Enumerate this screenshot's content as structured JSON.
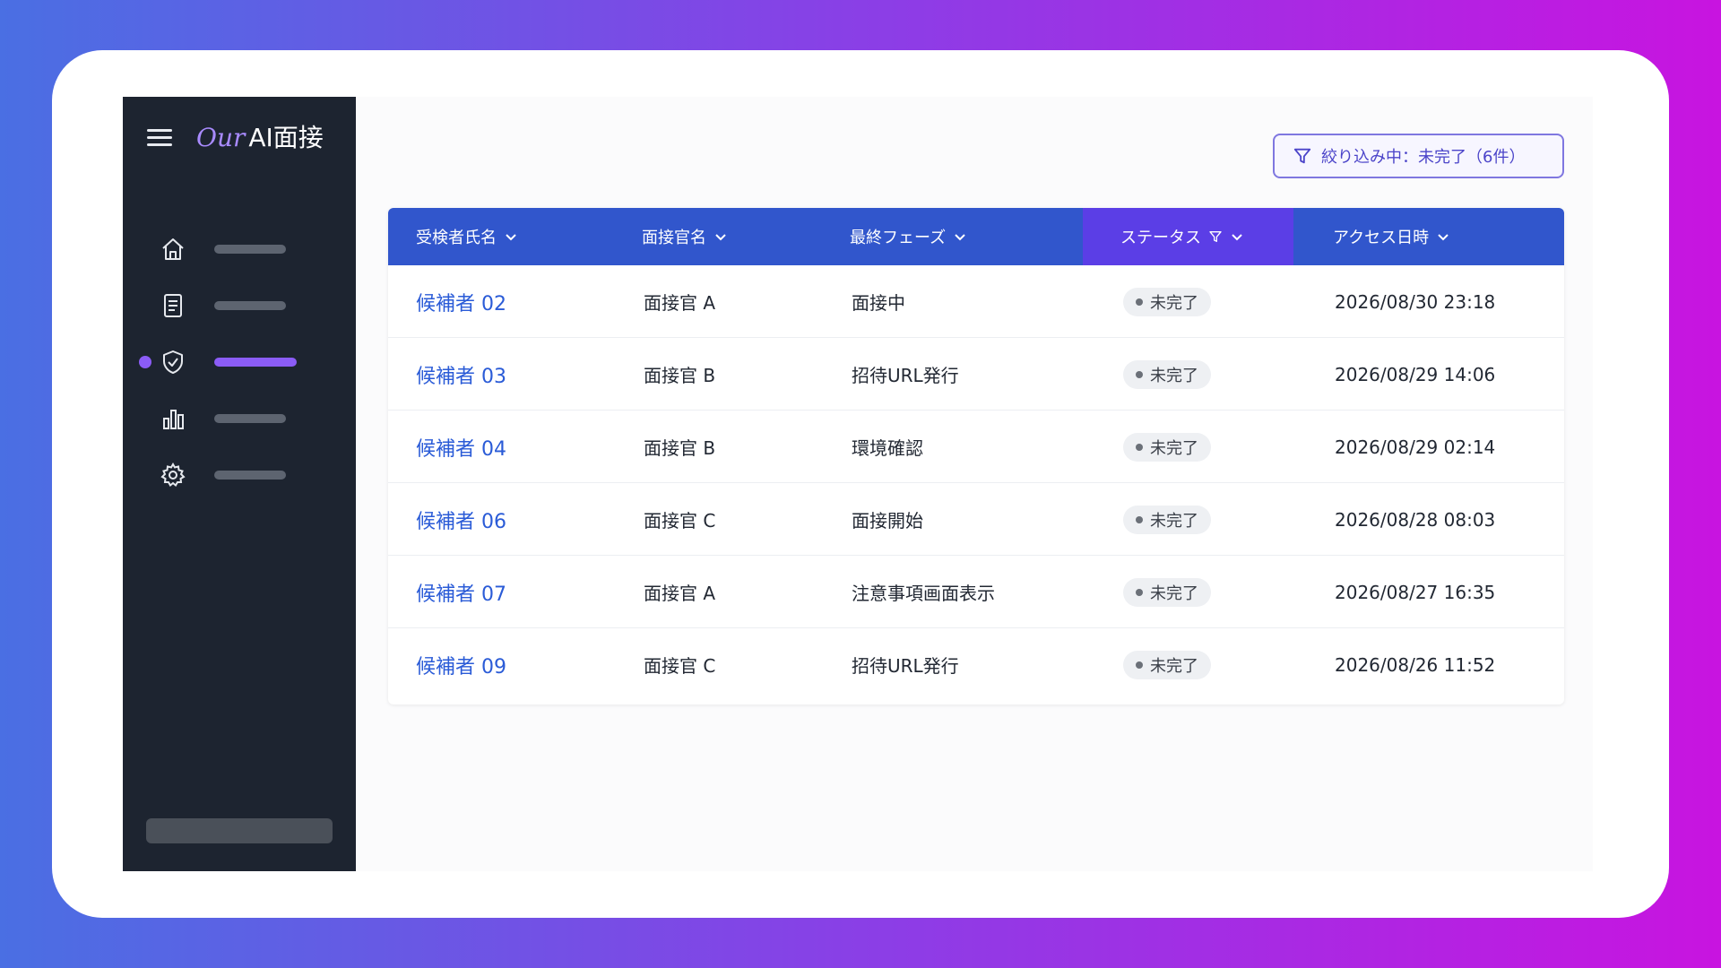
{
  "brand": {
    "prefix": "Our",
    "name": "AI面接"
  },
  "sidebar": {
    "items": [
      {
        "icon": "home-icon",
        "active": false
      },
      {
        "icon": "document-icon",
        "active": false
      },
      {
        "icon": "shield-check-icon",
        "active": true
      },
      {
        "icon": "bar-chart-icon",
        "active": false
      },
      {
        "icon": "gear-icon",
        "active": false
      }
    ]
  },
  "filter_chip": {
    "label": "絞り込み中：未完了（6件）"
  },
  "table": {
    "headers": [
      "受検者氏名",
      "面接官名",
      "最終フェーズ",
      "ステータス",
      "アクセス日時"
    ],
    "rows": [
      {
        "candidate": "候補者 02",
        "interviewer": "面接官 A",
        "phase": "面接中",
        "status": "未完了",
        "access": "2026/08/30  23:18"
      },
      {
        "candidate": "候補者 03",
        "interviewer": "面接官 B",
        "phase": "招待URL発行",
        "status": "未完了",
        "access": "2026/08/29  14:06"
      },
      {
        "candidate": "候補者 04",
        "interviewer": "面接官 B",
        "phase": "環境確認",
        "status": "未完了",
        "access": "2026/08/29  02:14"
      },
      {
        "candidate": "候補者 06",
        "interviewer": "面接官 C",
        "phase": "面接開始",
        "status": "未完了",
        "access": "2026/08/28  08:03"
      },
      {
        "candidate": "候補者 07",
        "interviewer": "面接官 A",
        "phase": "注意事項画面表示",
        "status": "未完了",
        "access": "2026/08/27  16:35"
      },
      {
        "candidate": "候補者 09",
        "interviewer": "面接官 C",
        "phase": "招待URL発行",
        "status": "未完了",
        "access": "2026/08/26  11:52"
      }
    ]
  },
  "colors": {
    "sidebar_bg": "#1d2430",
    "accent": "#8b5cf6",
    "table_header": "#3156cc",
    "link": "#2a5bd7"
  }
}
